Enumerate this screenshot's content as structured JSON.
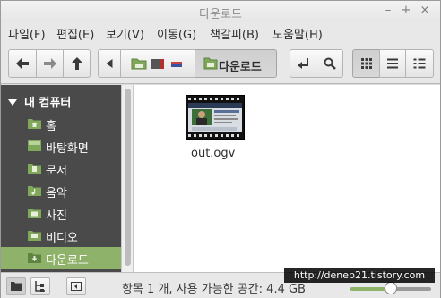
{
  "window": {
    "title": "다운로드"
  },
  "menu": {
    "items": [
      "파일(F)",
      "편집(E)",
      "보기(V)",
      "이동(G)",
      "책갈피(B)",
      "도움말(H)"
    ]
  },
  "toolbar": {
    "back_icon": "arrow-left-icon",
    "forward_icon": "arrow-right-icon",
    "up_icon": "arrow-up-icon",
    "breadcrumb_current": "다운로드",
    "toggle_location_icon": "location-toggle-icon",
    "search_icon": "search-icon",
    "view_modes": [
      "icon-view",
      "list-view",
      "compact-view"
    ],
    "active_view": "icon-view"
  },
  "sidebar": {
    "heading": "내 컴퓨터",
    "items": [
      {
        "label": "홈",
        "icon": "home-folder-icon"
      },
      {
        "label": "바탕화면",
        "icon": "desktop-icon"
      },
      {
        "label": "문서",
        "icon": "documents-folder-icon"
      },
      {
        "label": "음악",
        "icon": "music-folder-icon"
      },
      {
        "label": "사진",
        "icon": "pictures-folder-icon"
      },
      {
        "label": "비디오",
        "icon": "videos-folder-icon"
      },
      {
        "label": "다운로드",
        "icon": "downloads-folder-icon",
        "active": true
      }
    ]
  },
  "files": [
    {
      "name": "out.ogv",
      "type": "video-thumbnail"
    }
  ],
  "status": {
    "text": "항목 1 개, 사용 가능한 공간: 4.4 GB",
    "zoom_level": 0.5
  },
  "watermark": "http://deneb21.tistory.com",
  "colors": {
    "accent": "#8fb26a",
    "sidebar_bg": "#4a4a4a"
  }
}
